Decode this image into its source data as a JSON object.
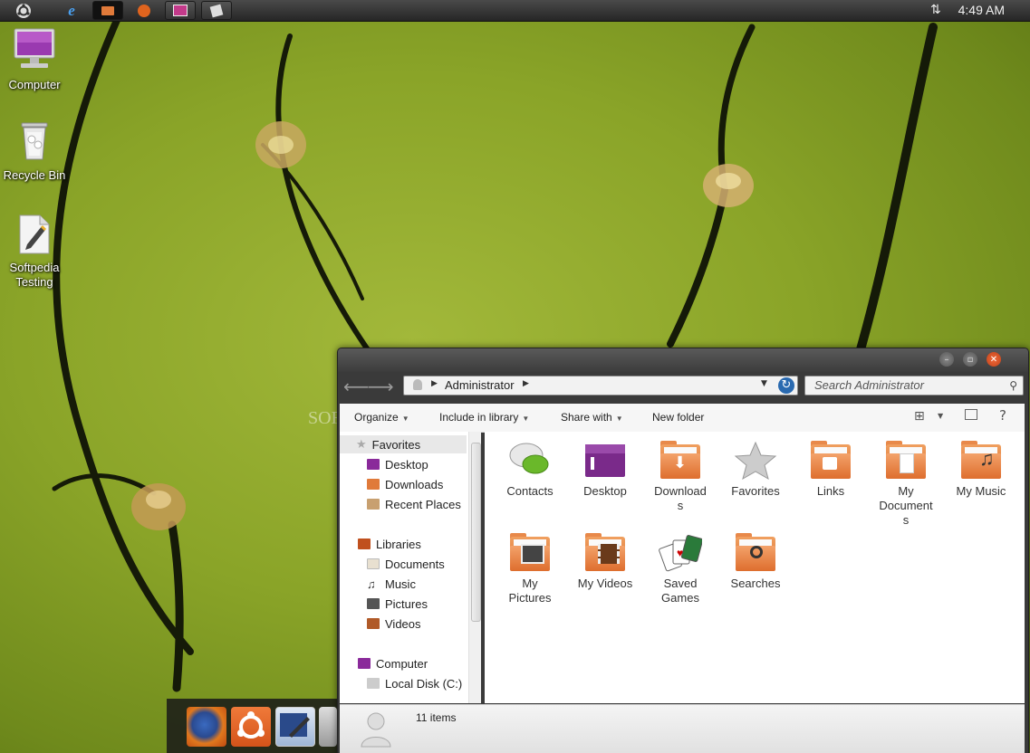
{
  "panel": {
    "clock": "4:49 AM",
    "tasks": [
      "ubuntu-menu",
      "internet-explorer",
      "file-manager",
      "media-player",
      "paint",
      "notes"
    ]
  },
  "desktop": {
    "icons": [
      {
        "label": "Computer"
      },
      {
        "label": "Recycle Bin"
      },
      {
        "label": "Softpedia Testing"
      }
    ]
  },
  "dock": {
    "items": [
      "firefox",
      "ubuntu",
      "writer",
      "misc"
    ]
  },
  "window": {
    "address": {
      "crumbs": [
        "Administrator"
      ]
    },
    "search": {
      "placeholder": "Search Administrator"
    },
    "toolbar": {
      "organize": "Organize",
      "include_in_library": "Include in library",
      "share_with": "Share with",
      "new_folder": "New folder"
    },
    "nav": {
      "favorites_header": "Favorites",
      "favorites": [
        "Desktop",
        "Downloads",
        "Recent Places"
      ],
      "libraries_header": "Libraries",
      "libraries": [
        "Documents",
        "Music",
        "Pictures",
        "Videos"
      ],
      "computer_header": "Computer",
      "computer": [
        "Local Disk (C:)"
      ]
    },
    "items": [
      {
        "label": "Contacts"
      },
      {
        "label": "Desktop"
      },
      {
        "label": "Download\ns"
      },
      {
        "label": "Favorites"
      },
      {
        "label": "Links"
      },
      {
        "label": "My\nDocument\ns"
      },
      {
        "label": "My Music"
      },
      {
        "label": "My\nPictures"
      },
      {
        "label": "My Videos"
      },
      {
        "label": "Saved\nGames"
      },
      {
        "label": "Searches"
      }
    ],
    "status": {
      "count": "11 items"
    }
  },
  "watermark": "SOFTPEDIA",
  "colors": {
    "accent_purple": "#7a2a7a",
    "folder_orange": "#e07a3a",
    "panel_dark": "#2b2b2b"
  }
}
